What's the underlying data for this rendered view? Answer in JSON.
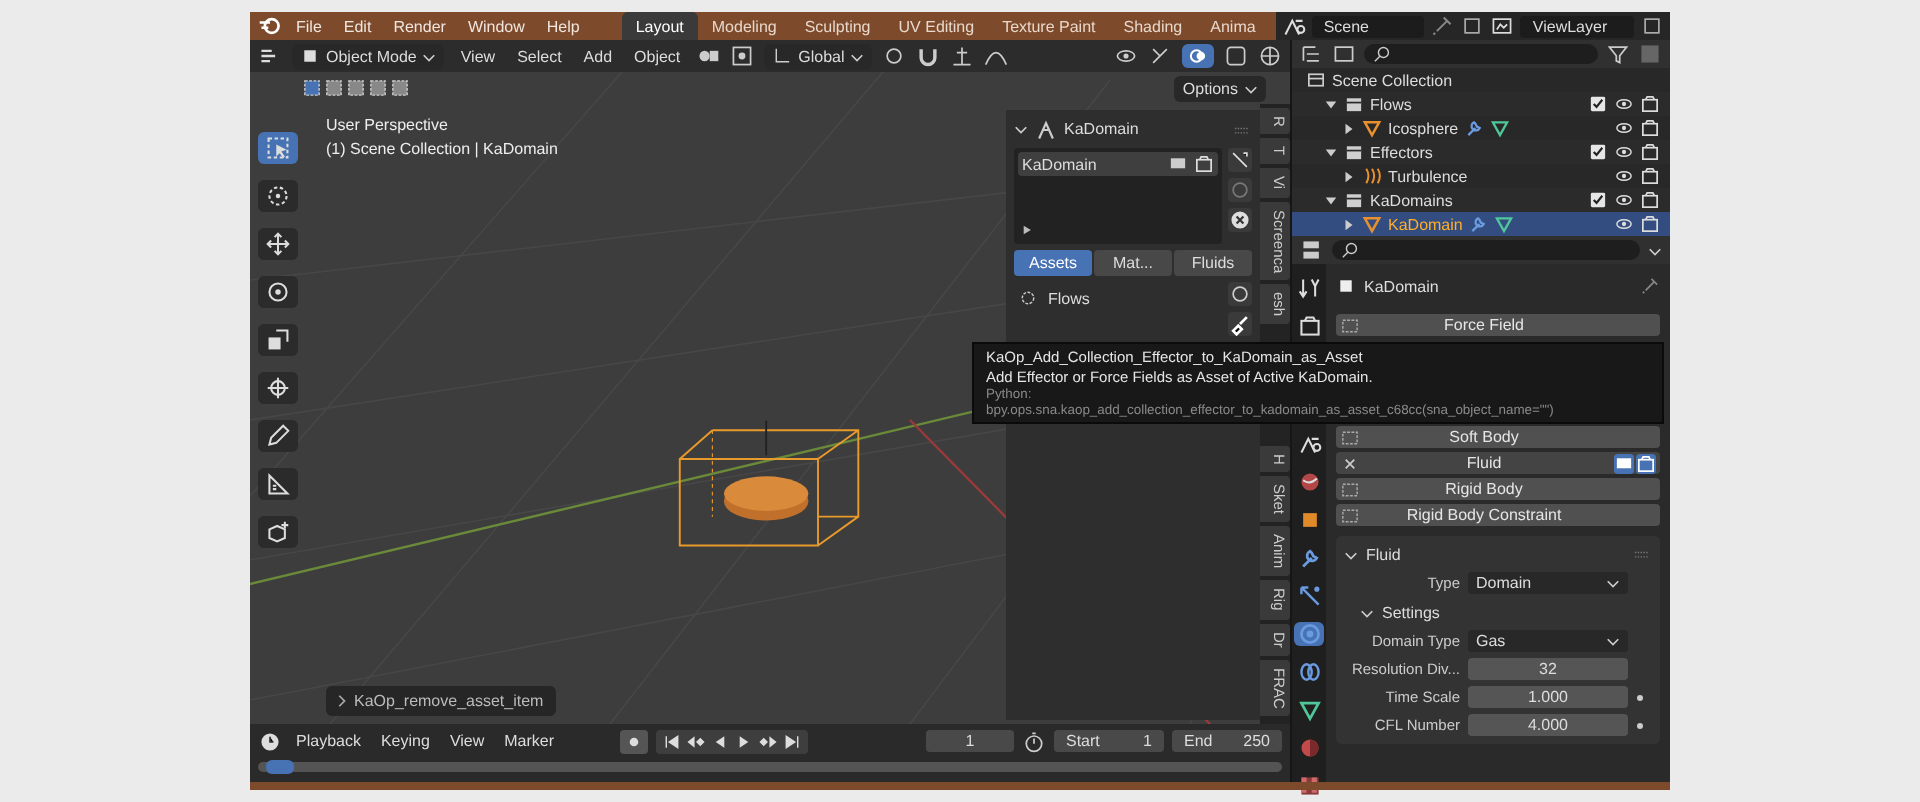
{
  "top_bar": {
    "menus": [
      "File",
      "Edit",
      "Render",
      "Window",
      "Help"
    ],
    "workspaces": [
      {
        "label": "Layout",
        "selected": true
      },
      {
        "label": "Modeling",
        "selected": false
      },
      {
        "label": "Sculpting",
        "selected": false
      },
      {
        "label": "UV Editing",
        "selected": false
      },
      {
        "label": "Texture Paint",
        "selected": false
      },
      {
        "label": "Shading",
        "selected": false
      },
      {
        "label": "Anima",
        "selected": false
      }
    ],
    "scene": "Scene",
    "view_layer": "ViewLayer"
  },
  "viewport": {
    "mode": "Object Mode",
    "menus": [
      "View",
      "Select",
      "Add",
      "Object"
    ],
    "orientation": "Global",
    "options": "Options",
    "tools": [
      {
        "kind": "select",
        "selected": true
      },
      {
        "kind": "cursor",
        "selected": false
      },
      {
        "kind": "move",
        "selected": false
      },
      {
        "kind": "rotate",
        "selected": false
      },
      {
        "kind": "scale",
        "selected": false
      },
      {
        "kind": "transform",
        "selected": false
      },
      {
        "kind": "annotate",
        "selected": false
      },
      {
        "kind": "measure",
        "selected": false
      },
      {
        "kind": "add_cube",
        "selected": false
      }
    ],
    "info_lines": [
      "User Perspective",
      "(1) Scene Collection | KaDomain"
    ],
    "last_operator": "KaOp_remove_asset_item",
    "side_panel": {
      "title": "KaDomain",
      "list_items": [
        {
          "label": "KaDomain",
          "selected": true
        }
      ],
      "tabs": [
        {
          "label": "Assets",
          "selected": true
        },
        {
          "label": "Mat...",
          "selected": false
        },
        {
          "label": "Fluids",
          "selected": false
        }
      ],
      "items": [
        "Flows"
      ]
    },
    "side_tabs": [
      "R",
      "T",
      "Vi",
      "Screenca",
      "esh",
      "H",
      "Sket",
      "Anim",
      "Rig",
      "Dr",
      "FRAC"
    ]
  },
  "tooltip": {
    "title": "KaOp_Add_Collection_Effector_to_KaDomain_as_Asset",
    "description": "Add Effector or Force Fields as Asset of Active KaDomain.",
    "python_label": "Python:",
    "python": "bpy.ops.sna.kaop_add_collection_effector_to_kadomain_as_asset_c68cc(sna_object_name=\"\")"
  },
  "timeline": {
    "menus": [
      "Playback",
      "Keying",
      "View",
      "Marker"
    ],
    "current_frame": "1",
    "start_label": "Start",
    "start": "1",
    "end_label": "End",
    "end": "250"
  },
  "outliner": {
    "tree": [
      {
        "label": "Scene Collection",
        "kind": "scene",
        "children": [
          {
            "label": "Flows",
            "kind": "collection",
            "expanded": true,
            "checked": true,
            "children": [
              {
                "label": "Icosphere",
                "kind": "mesh",
                "expanded": false,
                "selected": false
              }
            ]
          },
          {
            "label": "Effectors",
            "kind": "collection",
            "expanded": true,
            "checked": true,
            "children": [
              {
                "label": "Turbulence",
                "kind": "force",
                "expanded": false,
                "selected": false
              }
            ]
          },
          {
            "label": "KaDomains",
            "kind": "collection",
            "expanded": true,
            "checked": true,
            "children": [
              {
                "label": "KaDomain",
                "kind": "mesh",
                "expanded": false,
                "selected": true
              }
            ]
          }
        ]
      }
    ]
  },
  "properties": {
    "tabs": [
      {
        "kind": "tool",
        "selected": false
      },
      {
        "kind": "render",
        "selected": false
      },
      {
        "kind": "scene",
        "selected": false
      },
      {
        "kind": "world",
        "selected": false
      },
      {
        "kind": "object",
        "selected": false
      },
      {
        "kind": "modifiers",
        "selected": false
      },
      {
        "kind": "particles",
        "selected": false
      },
      {
        "kind": "physics",
        "selected": true
      },
      {
        "kind": "constraints",
        "selected": false
      },
      {
        "kind": "data",
        "selected": false
      },
      {
        "kind": "material",
        "selected": false
      },
      {
        "kind": "texture",
        "selected": false
      }
    ],
    "object_name": "KaDomain",
    "physics": [
      {
        "label": "Force Field",
        "enabled": false
      },
      {
        "label": "Soft Body",
        "enabled": false
      },
      {
        "label": "Fluid",
        "enabled": true
      },
      {
        "label": "Rigid Body",
        "enabled": false
      },
      {
        "label": "Rigid Body Constraint",
        "enabled": false
      }
    ],
    "fluid": {
      "title": "Fluid",
      "type_label": "Type",
      "type": "Domain",
      "settings_title": "Settings",
      "fields": [
        {
          "label": "Domain Type",
          "value": "Gas",
          "kind": "dropdown",
          "animatable": false
        },
        {
          "label": "Resolution Div...",
          "value": "32",
          "kind": "number",
          "animatable": false
        },
        {
          "label": "Time Scale",
          "value": "1.000",
          "kind": "number",
          "animatable": true
        },
        {
          "label": "CFL Number",
          "value": "4.000",
          "kind": "number",
          "animatable": true
        }
      ]
    }
  }
}
